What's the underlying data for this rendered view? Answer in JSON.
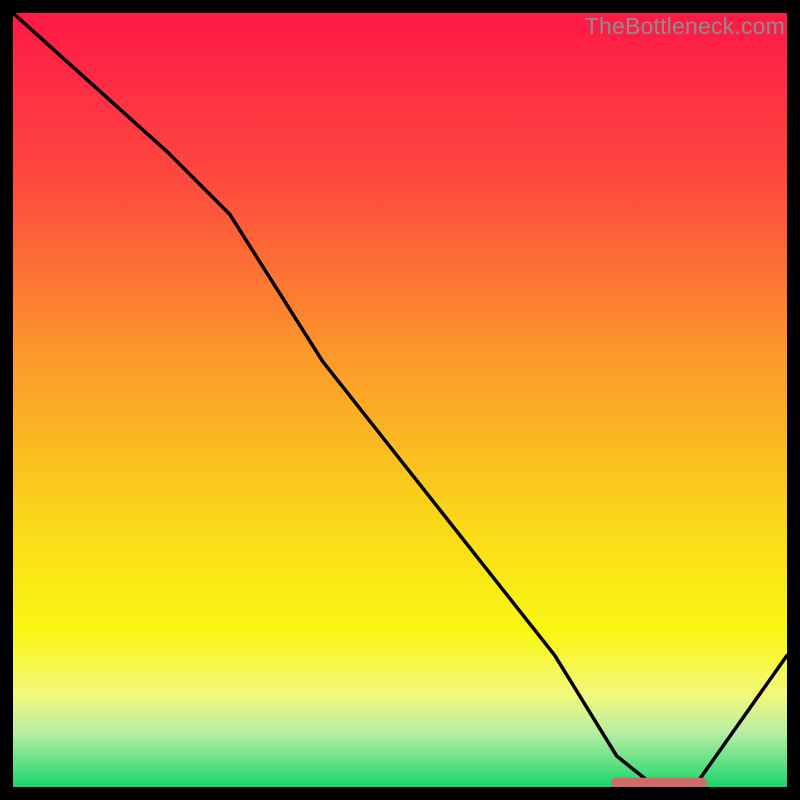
{
  "watermark": "TheBottleneck.com",
  "colors": {
    "frame": "#000000",
    "curve": "#000000",
    "marker": "#cf6a66",
    "gradient_stops": [
      {
        "pct": 0,
        "c": "#fe1846"
      },
      {
        "pct": 22,
        "c": "#fd4a3e"
      },
      {
        "pct": 45,
        "c": "#fb9b2a"
      },
      {
        "pct": 68,
        "c": "#fadd17"
      },
      {
        "pct": 80,
        "c": "#faf714"
      },
      {
        "pct": 88,
        "c": "#f3f87c"
      },
      {
        "pct": 93,
        "c": "#b7eea2"
      },
      {
        "pct": 97,
        "c": "#5ee083"
      },
      {
        "pct": 100,
        "c": "#18d56b"
      }
    ]
  },
  "chart_data": {
    "type": "line",
    "title": "",
    "xlabel": "",
    "ylabel": "",
    "xlim": [
      0,
      100
    ],
    "ylim": [
      0,
      100
    ],
    "x": [
      0,
      10,
      20,
      28,
      40,
      55,
      70,
      78,
      83,
      88,
      100
    ],
    "values": [
      100,
      91,
      82,
      74,
      55,
      36,
      17,
      4,
      0,
      0,
      17
    ],
    "marker_segment": {
      "x0": 78,
      "x1": 89,
      "y": 0.5
    }
  }
}
